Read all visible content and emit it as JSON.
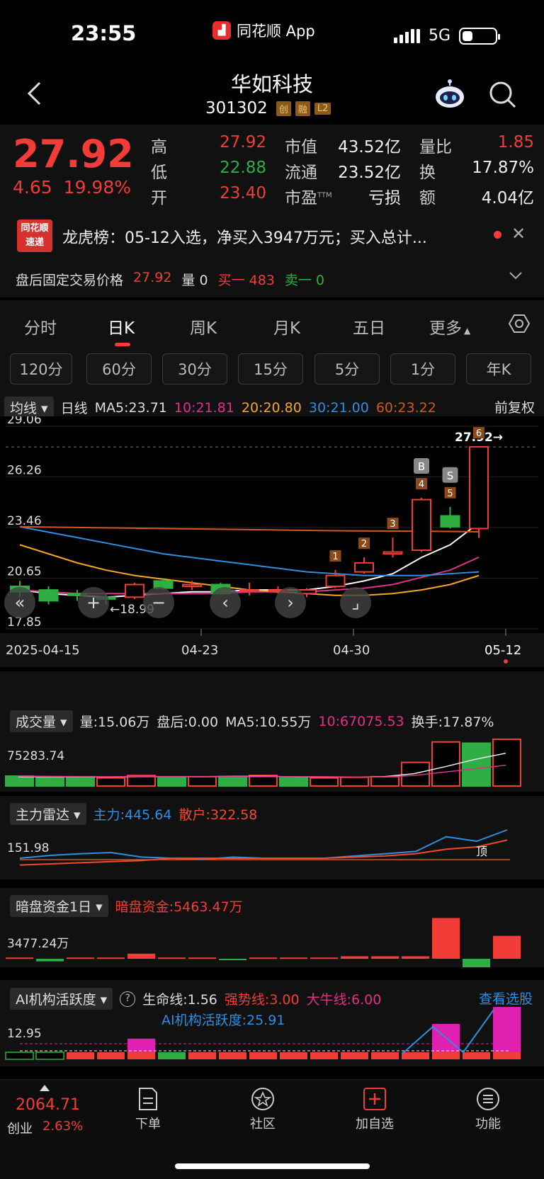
{
  "status_bar": {
    "time": "23:55",
    "app_name": "同花顺 App",
    "network": "5G"
  },
  "header": {
    "stock_name": "华如科技",
    "stock_code": "301302",
    "tags": [
      "创",
      "融",
      "L2"
    ]
  },
  "quote": {
    "price": "27.92",
    "change": "4.65",
    "change_pct": "19.98%",
    "high_label": "高",
    "high": "27.92",
    "low_label": "低",
    "low": "22.88",
    "open_label": "开",
    "open": "23.40",
    "mcap_label": "市值",
    "mcap": "43.52亿",
    "float_label": "流通",
    "float": "23.52亿",
    "pe_label": "市盈",
    "pe_sup": "TTM",
    "pe": "亏损",
    "vol_ratio_label": "量比",
    "vol_ratio": "1.85",
    "turnover_label": "换",
    "turnover": "17.87%",
    "amount_label": "额",
    "amount": "4.04亿"
  },
  "news": {
    "logo_line1": "同花顺",
    "logo_line2": "速递",
    "text": "龙虎榜：05-12入选，净买入3947万元；买入总计..."
  },
  "fixed_trade": {
    "label": "盘后固定交易价格",
    "price": "27.92",
    "volume": "量 0",
    "buy1": "买一 483",
    "sell1": "卖一 0"
  },
  "tabs": [
    "分时",
    "日K",
    "周K",
    "月K",
    "五日",
    "更多"
  ],
  "active_tab": "日K",
  "periods": [
    "120分",
    "60分",
    "30分",
    "15分",
    "5分",
    "1分",
    "年K"
  ],
  "ma_row": {
    "selector": "均线",
    "line_type": "日线",
    "ma5": "MA5:23.71",
    "ma10": "10:21.81",
    "ma20": "20:20.80",
    "ma30": "30:21.00",
    "ma60": "60:23.22",
    "adjust": "前复权"
  },
  "colors": {
    "up": "#f23c37",
    "down": "#2fae44",
    "ma5": "#ffffff",
    "ma10": "#e0308c",
    "ma20": "#f5a623",
    "ma30": "#2d8fe0",
    "ma60": "#d0581e"
  },
  "chart_data": {
    "type": "candlestick",
    "y_ticks": [
      "29.06",
      "26.26",
      "23.46",
      "20.65",
      "17.85"
    ],
    "x_labels": [
      "2025-04-15",
      "04-23",
      "04-30",
      "05-12"
    ],
    "last_price_label": "27.92",
    "low_marker": "←18.99",
    "candles": [
      {
        "o": 20.2,
        "c": 19.9,
        "h": 20.5,
        "l": 19.6
      },
      {
        "o": 20.0,
        "c": 19.4,
        "h": 20.2,
        "l": 19.2
      },
      {
        "o": 19.8,
        "c": 19.7,
        "h": 20.0,
        "l": 19.4
      },
      {
        "o": 19.6,
        "c": 19.5,
        "h": 19.8,
        "l": 19.2
      },
      {
        "o": 19.6,
        "c": 20.3,
        "h": 20.4,
        "l": 19.5
      },
      {
        "o": 20.5,
        "c": 20.1,
        "h": 20.6,
        "l": 20.0
      },
      {
        "o": 20.2,
        "c": 20.3,
        "h": 20.5,
        "l": 20.0
      },
      {
        "o": 20.3,
        "c": 19.8,
        "h": 20.4,
        "l": 19.7
      },
      {
        "o": 20.0,
        "c": 20.0,
        "h": 20.4,
        "l": 19.7
      },
      {
        "o": 20.0,
        "c": 20.0,
        "h": 20.2,
        "l": 19.8
      },
      {
        "o": 19.8,
        "c": 20.0,
        "h": 20.1,
        "l": 19.6
      },
      {
        "o": 20.2,
        "c": 20.8,
        "h": 21.1,
        "l": 20.1
      },
      {
        "o": 21.0,
        "c": 21.5,
        "h": 21.8,
        "l": 20.9
      },
      {
        "o": 22.0,
        "c": 22.1,
        "h": 22.9,
        "l": 21.8
      },
      {
        "o": 22.2,
        "c": 25.0,
        "h": 25.1,
        "l": 22.1
      },
      {
        "o": 24.1,
        "c": 23.5,
        "h": 24.6,
        "l": 23.4
      },
      {
        "o": 23.4,
        "c": 27.92,
        "h": 27.92,
        "l": 22.88
      }
    ],
    "markers": [
      {
        "index": 11,
        "text": "1"
      },
      {
        "index": 12,
        "text": "2"
      },
      {
        "index": 13,
        "text": "3"
      },
      {
        "index": 14,
        "text": "4",
        "signal": "B"
      },
      {
        "index": 15,
        "text": "5",
        "signal": "S"
      },
      {
        "index": 16,
        "text": "6"
      }
    ],
    "ma_series": [
      {
        "name": "MA5",
        "values": [
          20.0,
          19.8,
          19.7,
          19.6,
          19.7,
          19.8,
          19.9,
          19.9,
          20.0,
          20.0,
          20.0,
          20.2,
          20.5,
          20.9,
          21.8,
          22.5,
          23.71
        ]
      },
      {
        "name": "10",
        "values": [
          20.0,
          19.9,
          19.8,
          19.8,
          19.8,
          19.8,
          19.8,
          19.8,
          19.9,
          19.9,
          19.9,
          20.0,
          20.1,
          20.3,
          20.7,
          21.1,
          21.81
        ]
      },
      {
        "name": "20",
        "values": [
          22.5,
          22.0,
          21.5,
          21.1,
          20.8,
          20.6,
          20.4,
          20.2,
          20.0,
          19.9,
          19.8,
          19.7,
          19.7,
          19.8,
          20.0,
          20.3,
          20.8
        ]
      },
      {
        "name": "30",
        "values": [
          23.5,
          23.2,
          22.9,
          22.6,
          22.3,
          22.0,
          21.8,
          21.6,
          21.4,
          21.2,
          21.0,
          20.9,
          20.8,
          20.8,
          20.8,
          20.9,
          21.0
        ]
      },
      {
        "name": "60",
        "values": [
          23.5,
          23.48,
          23.46,
          23.44,
          23.42,
          23.4,
          23.38,
          23.36,
          23.34,
          23.32,
          23.3,
          23.28,
          23.27,
          23.26,
          23.25,
          23.24,
          23.22
        ]
      }
    ],
    "ylim": [
      17.85,
      29.06
    ]
  },
  "volume_panel": {
    "label": "成交量",
    "vol": "量:15.06万",
    "after": "盘后:0.00",
    "ma5": "MA5:10.55万",
    "ma10": "10:67075.53",
    "turnover": "换手:17.87%",
    "max_tick": "75283.74",
    "values": [
      3.2,
      3.0,
      3.0,
      2.6,
      3.4,
      3.0,
      3.0,
      3.0,
      3.4,
      2.8,
      2.6,
      2.8,
      3.0,
      7.6,
      14.2,
      13.8,
      15.06
    ],
    "up": [
      false,
      false,
      false,
      true,
      true,
      false,
      true,
      false,
      true,
      false,
      true,
      true,
      true,
      true,
      true,
      false,
      true
    ]
  },
  "radar_panel": {
    "label": "主力雷达",
    "main": "主力:445.64",
    "retail": "散户:322.58",
    "tick": "151.98",
    "top_marker": "顶"
  },
  "dark_pool_panel": {
    "label": "暗盘资金1日",
    "value": "暗盘资金:5463.47万",
    "tick": "3477.24万",
    "values": [
      0.1,
      -0.2,
      0.1,
      0.1,
      0.4,
      0.1,
      0.1,
      -0.1,
      0.1,
      0.1,
      0.1,
      0.2,
      0.2,
      0.2,
      3.2,
      -1.0,
      1.8
    ]
  },
  "ai_panel": {
    "label": "AI机构活跃度",
    "lifeline": "生命线:1.56",
    "strong": "强势线:3.00",
    "bull": "大牛线:6.00",
    "ai_value": "AI机构活跃度:25.91",
    "view": "查看选股",
    "tick": "12.95"
  },
  "bottom": {
    "index_value": "2064.71",
    "index_name": "创业",
    "index_pct": "2.63%",
    "nav": [
      "下单",
      "社区",
      "加自选",
      "功能"
    ]
  }
}
